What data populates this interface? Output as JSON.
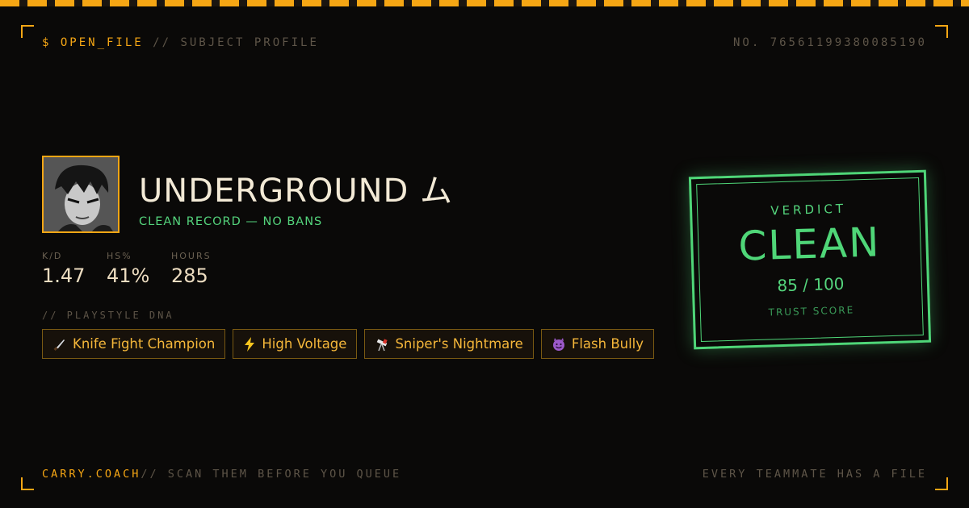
{
  "header": {
    "command": "$ OPEN_FILE",
    "section": "// SUBJECT PROFILE",
    "file_number": "NO. 76561199380085190"
  },
  "profile": {
    "name": "UNDERGROUND ム",
    "record": "CLEAN RECORD — NO BANS"
  },
  "stats": [
    {
      "label": "K/D",
      "value": "1.47"
    },
    {
      "label": "HS%",
      "value": "41%"
    },
    {
      "label": "HOURS",
      "value": "285"
    }
  ],
  "playstyle": {
    "label": "// PLAYSTYLE DNA",
    "tags": [
      {
        "icon": "knife-icon",
        "label": "Knife Fight Champion"
      },
      {
        "icon": "lightning-icon",
        "label": "High Voltage"
      },
      {
        "icon": "telescope-icon",
        "label": "Sniper's Nightmare"
      },
      {
        "icon": "devil-icon",
        "label": "Flash Bully"
      }
    ]
  },
  "verdict": {
    "label": "VERDICT",
    "result": "CLEAN",
    "score": "85 / 100",
    "score_label": "TRUST SCORE"
  },
  "footer": {
    "brand": "CARRY.COACH",
    "tagline": "// SCAN THEM BEFORE YOU QUEUE",
    "right": "EVERY TEAMMATE HAS A FILE"
  },
  "colors": {
    "accent": "#f5a614",
    "clean_green": "#4fd678",
    "background": "#0a0908"
  }
}
